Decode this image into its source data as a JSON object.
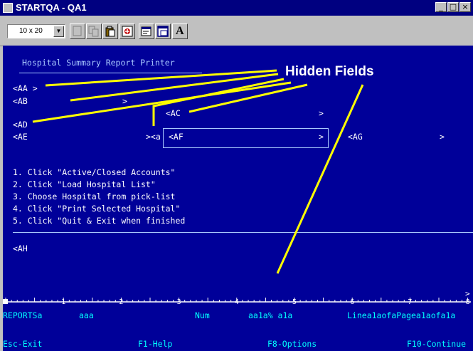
{
  "window": {
    "title": "STARTQA - QA1",
    "min_icon": "minimize-icon",
    "max_icon": "maximize-icon",
    "close_icon": "close-icon"
  },
  "toolbar": {
    "font_size_value": "10 x 20",
    "buttons": [
      "blank-doc-icon",
      "copy-icon",
      "paste-icon",
      "transfer-icon",
      "properties-icon",
      "window-icon",
      "font-A-icon"
    ],
    "font_button_label": "A"
  },
  "screen": {
    "title": "Hospital Summary Report Printer",
    "fields": {
      "aa": "<AA >",
      "ab": "<AB",
      "ab_close": ">",
      "ac": "<AC",
      "ac_close": ">",
      "ad": "<AD",
      "ae": "<AE",
      "ae_close": "><a",
      "af": "<AF",
      "af_close": ">",
      "ag": "<AG",
      "ag_close": ">",
      "ah": "<AH"
    },
    "instructions": [
      "1. Click \"Active/Closed Accounts\"",
      "2. Click \"Load Hospital List\"",
      "3. Choose Hospital from pick-list",
      "4. Click \"Print Selected Hospital\"",
      "5. Click \"Quit & Exit when finished"
    ],
    "callout": "Hidden Fields",
    "ruler_digits": [
      "1",
      "2",
      "3",
      "4",
      "5",
      "6",
      "7",
      "8"
    ],
    "ruler_right_mark": ">",
    "status": {
      "app": "REPORTSa",
      "field2": "aaa",
      "num": "Num",
      "field4": "aa1a% a1a",
      "linepage": "Linea1aofaPagea1aofa1a"
    },
    "fkeys": {
      "esc": "Esc-Exit",
      "f1": "F1-Help",
      "f8": "F8-Options",
      "f10": "F10-Continue"
    }
  },
  "colors": {
    "screen_bg": "#000099",
    "screen_text": "#a8c8ff",
    "status_text": "#00ffff",
    "titlebar": "#000080",
    "callout_lines": "#ffff00"
  }
}
